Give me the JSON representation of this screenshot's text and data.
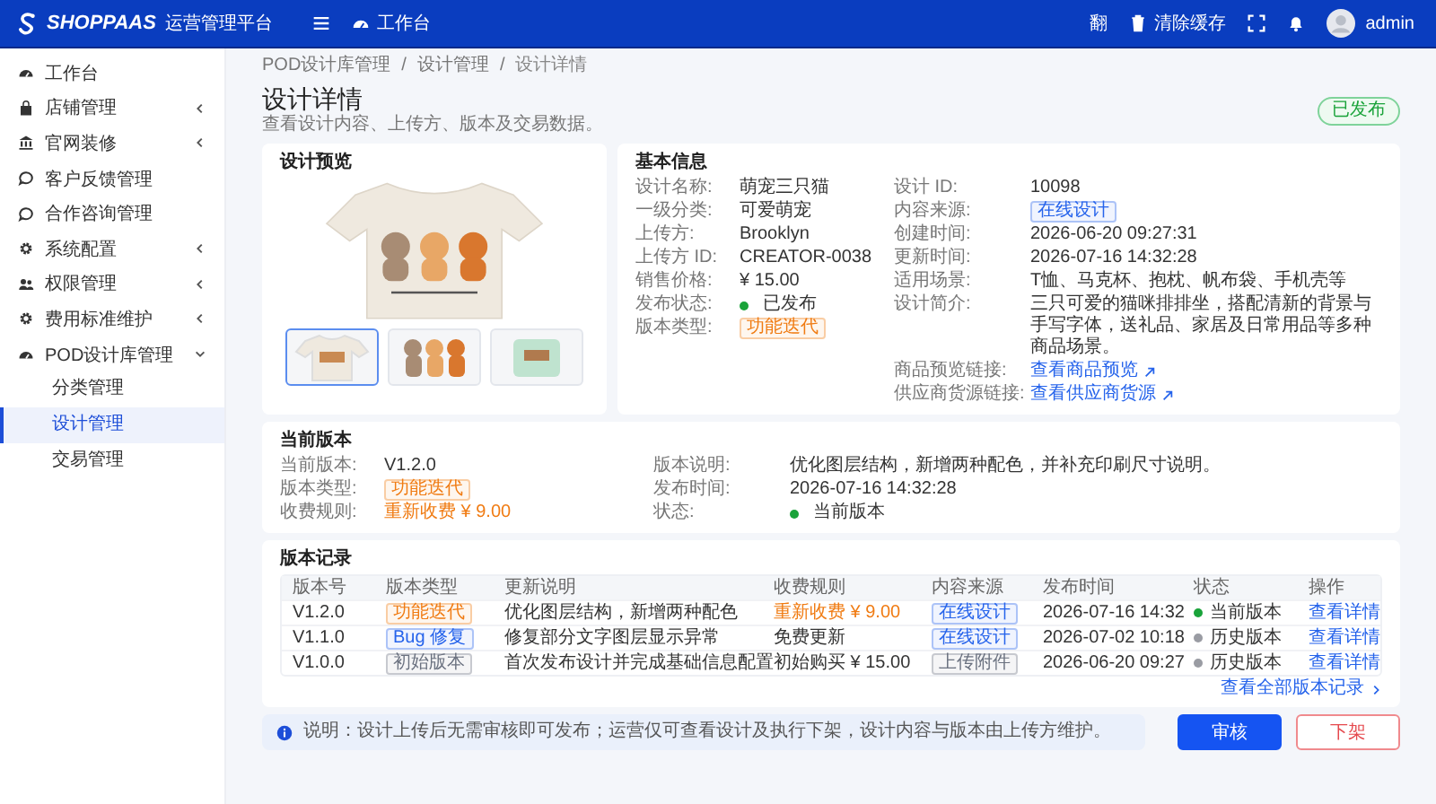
{
  "header": {
    "brand": "SHOPPAAS",
    "platform": "运营管理平台",
    "nav_label": "工作台",
    "language": "翻",
    "clear_cache": "清除缓存",
    "user": "admin"
  },
  "sidebar": {
    "items": [
      {
        "label": "工作台",
        "expandable": false,
        "selected": false
      },
      {
        "label": "店铺管理",
        "expandable": true,
        "expanded": false,
        "selected": false
      },
      {
        "label": "官网装修",
        "expandable": true,
        "expanded": false,
        "selected": false
      },
      {
        "label": "客户反馈管理",
        "expandable": false,
        "selected": false
      },
      {
        "label": "合作咨询管理",
        "expandable": false,
        "selected": false
      },
      {
        "label": "系统配置",
        "expandable": true,
        "expanded": false,
        "selected": false
      },
      {
        "label": "权限管理",
        "expandable": true,
        "expanded": false,
        "selected": false
      },
      {
        "label": "费用标准维护",
        "expandable": true,
        "expanded": false,
        "selected": false
      },
      {
        "label": "POD设计库管理",
        "expandable": true,
        "expanded": true,
        "selected": false,
        "children": [
          {
            "label": "分类管理",
            "selected": false
          },
          {
            "label": "设计管理",
            "selected": true
          },
          {
            "label": "交易管理",
            "selected": false
          }
        ]
      }
    ]
  },
  "breadcrumb": {
    "separator": "/",
    "items": [
      "POD设计库管理",
      "设计管理",
      "设计详情"
    ]
  },
  "page": {
    "title": "设计详情",
    "subtitle": "查看设计内容、上传方、版本及交易数据。",
    "status": "已发布"
  },
  "preview": {
    "title": "设计预览",
    "thumbnails": [
      {
        "kind": "tshirt",
        "selected": true
      },
      {
        "kind": "cats",
        "selected": false
      },
      {
        "kind": "pillow",
        "selected": false
      }
    ]
  },
  "basic_info": {
    "title": "基本信息",
    "left": [
      {
        "label": "设计名称:",
        "value": "萌宠三只猫",
        "kind": "text"
      },
      {
        "label": "一级分类:",
        "value": "可爱萌宠",
        "kind": "text"
      },
      {
        "label": "上传方:",
        "value": "Brooklyn",
        "kind": "text"
      },
      {
        "label": "上传方 ID:",
        "value": "CREATOR-0038",
        "kind": "text"
      },
      {
        "label": "销售价格:",
        "value": "¥ 15.00",
        "kind": "text"
      },
      {
        "label": "发布状态:",
        "value": "已发布",
        "kind": "status",
        "color": "#1aa33a"
      },
      {
        "label": "版本类型:",
        "value": "功能迭代",
        "kind": "tag",
        "color": "#f07b12"
      }
    ],
    "right": [
      {
        "label": "设计 ID:",
        "value": "10098",
        "kind": "text"
      },
      {
        "label": "内容来源:",
        "value": "在线设计",
        "kind": "tag",
        "color": "#2563eb"
      },
      {
        "label": "创建时间:",
        "value": "2026-06-20 09:27:31",
        "kind": "text"
      },
      {
        "label": "更新时间:",
        "value": "2026-07-16 14:32:28",
        "kind": "text"
      },
      {
        "label": "适用场景:",
        "value": "T恤、马克杯、抱枕、帆布袋、手机壳等",
        "kind": "text"
      },
      {
        "label": "设计简介:",
        "value": "三只可爱的猫咪排排坐，搭配清新的背景与手写字体，送礼品、家居及日常用品等多种商品场景。",
        "kind": "text"
      },
      {
        "label": "商品预览链接:",
        "value": "查看商品预览",
        "kind": "link"
      },
      {
        "label": "供应商货源链接:",
        "value": "查看供应商货源",
        "kind": "link"
      }
    ]
  },
  "current_version": {
    "title": "当前版本",
    "left": [
      {
        "label": "当前版本:",
        "value": "V1.2.0",
        "kind": "text"
      },
      {
        "label": "版本类型:",
        "value": "功能迭代",
        "kind": "tag",
        "color": "#f07b12"
      },
      {
        "label": "收费规则:",
        "value": "重新收费 ¥ 9.00",
        "kind": "charge"
      }
    ],
    "right": [
      {
        "label": "版本说明:",
        "value": "优化图层结构，新增两种配色，并补充印刷尺寸说明。",
        "kind": "text"
      },
      {
        "label": "发布时间:",
        "value": "2026-07-16 14:32:28",
        "kind": "text"
      },
      {
        "label": "状态:",
        "value": "当前版本",
        "kind": "status",
        "color": "#1aa33a"
      }
    ]
  },
  "version_records": {
    "title": "版本记录",
    "columns": [
      "版本号",
      "版本类型",
      "更新说明",
      "收费规则",
      "内容来源",
      "发布时间",
      "状态",
      "操作"
    ],
    "rows": [
      {
        "version": "V1.2.0",
        "type": {
          "label": "功能迭代",
          "color": "#f07b12"
        },
        "note": "优化图层结构，新增两种配色",
        "fee": "重新收费 ¥ 9.00",
        "fee_highlight": true,
        "source": {
          "label": "在线设计",
          "color": "#2563eb"
        },
        "time": "2026-07-16 14:32",
        "status": {
          "label": "当前版本",
          "color": "#1aa33a"
        },
        "action": "查看详情"
      },
      {
        "version": "V1.1.0",
        "type": {
          "label": "Bug 修复",
          "color": "#2563eb"
        },
        "note": "修复部分文字图层显示异常",
        "fee": "免费更新",
        "fee_highlight": false,
        "source": {
          "label": "在线设计",
          "color": "#2563eb"
        },
        "time": "2026-07-02 10:18",
        "status": {
          "label": "历史版本",
          "color": "#9a9ca3"
        },
        "action": "查看详情"
      },
      {
        "version": "V1.0.0",
        "type": {
          "label": "初始版本",
          "color": "#6b7280"
        },
        "note": "首次发布设计并完成基础信息配置",
        "fee": "初始购买 ¥ 15.00",
        "fee_highlight": false,
        "source": {
          "label": "上传附件",
          "color": "#6b7280"
        },
        "time": "2026-06-20 09:27",
        "status": {
          "label": "历史版本",
          "color": "#9a9ca3"
        },
        "action": "查看详情"
      }
    ],
    "more_link": "查看全部版本记录"
  },
  "footer": {
    "note": "说明：设计上传后无需审核即可发布；运营仅可查看设计及执行下架，设计内容与版本由上传方维护。",
    "buttons": [
      {
        "label": "审核",
        "kind": "primary"
      },
      {
        "label": "下架",
        "kind": "danger"
      }
    ]
  }
}
